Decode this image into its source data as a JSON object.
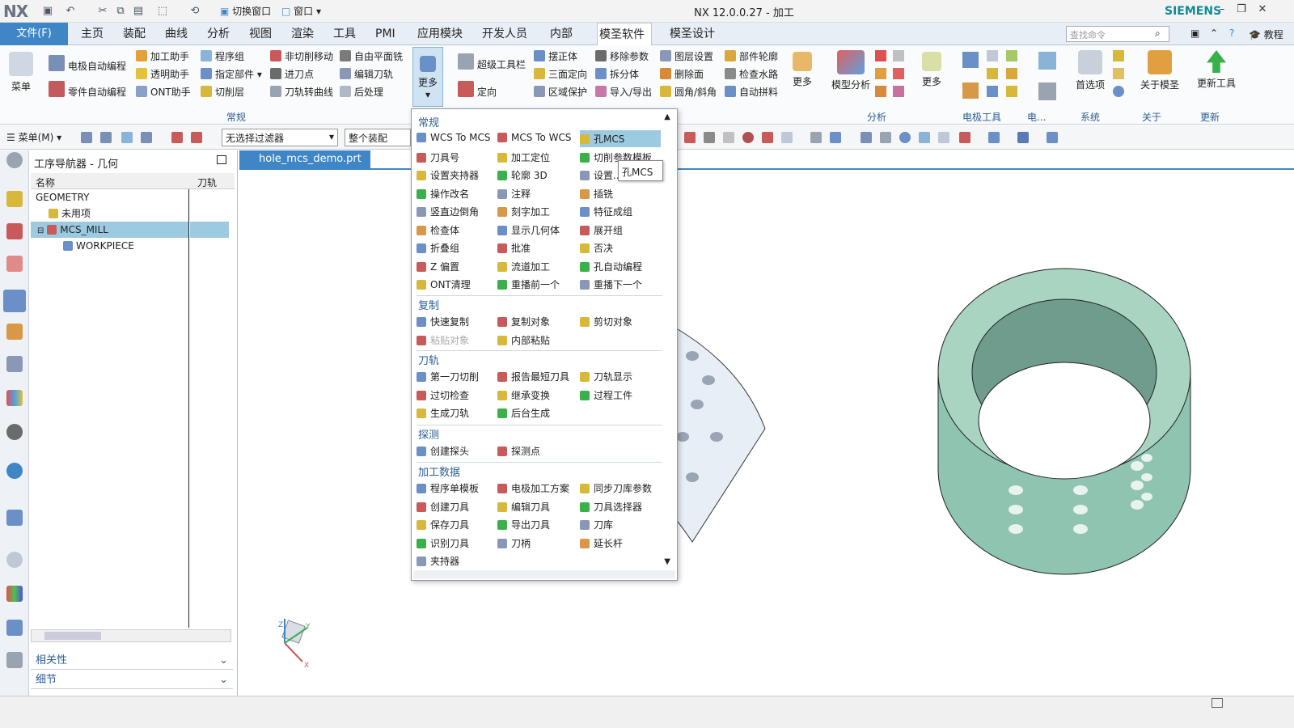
{
  "app": {
    "logo": "NX",
    "title": "NX 12.0.0.27 - 加工",
    "brand": "SIEMENS",
    "switch_window": "切换窗口",
    "window_menu": "窗口"
  },
  "menu_tabs": {
    "file": "文件(F)",
    "items": [
      "主页",
      "装配",
      "曲线",
      "分析",
      "视图",
      "渲染",
      "工具",
      "PMI",
      "应用模块",
      "开发人员",
      "内部",
      "模圣软件",
      "模圣设计"
    ],
    "active": "模圣软件",
    "search_placeholder": "查找命令",
    "tutorial": "教程"
  },
  "ribbon": {
    "menu_btn": "菜单",
    "col1": [
      "电极自动编程",
      "零件自动编程"
    ],
    "col2": [
      "加工助手",
      "透明助手",
      "ONT助手"
    ],
    "col3": [
      "程序组",
      "指定部件",
      "切削层"
    ],
    "col4": [
      "非切削移动",
      "进刀点",
      "刀轨转曲线"
    ],
    "col5": [
      "自由平面铣",
      "编辑刀轨",
      "后处理"
    ],
    "more1": "更多",
    "group_general": "常规",
    "super_toolbar": "超级工具栏",
    "orient": "定向",
    "col6": [
      "摆正体",
      "三面定向",
      "区域保护"
    ],
    "col7": [
      "移除参数",
      "拆分体",
      "导入/导出"
    ],
    "col8": [
      "图层设置",
      "删除面",
      "圆角/斜角"
    ],
    "col9": [
      "部件轮廓",
      "检查水路",
      "自动拼料"
    ],
    "more2": "更多",
    "model_analysis": "模型分析",
    "group_analysis": "分析",
    "more3": "更多",
    "group_electrode": "电极工具",
    "group_electrode2": "电...",
    "group_system": "系统",
    "preferences": "首选项",
    "about": "关于模圣",
    "group_about": "关于",
    "update_tools": "更新工具",
    "group_update": "更新"
  },
  "toolbar2": {
    "menu": "菜单(M)",
    "filter": "无选择过滤器",
    "assembly": "整个装配"
  },
  "navigator": {
    "title": "工序导航器 - 几何",
    "col_name": "名称",
    "col_path": "刀轨",
    "rows": [
      "GEOMETRY",
      "未用项",
      "MCS_MILL",
      "WORKPIECE"
    ],
    "dependencies": "相关性",
    "details": "细节"
  },
  "graphics": {
    "doc_tab": "hole_mcs_demo.prt"
  },
  "dropdown": {
    "sec_general": "常规",
    "general": [
      [
        "WCS To MCS",
        "MCS To WCS",
        "孔MCS"
      ],
      [
        "刀具号",
        "加工定位",
        "切削参数模板"
      ],
      [
        "设置夹持器",
        "轮廓 3D",
        "设置..."
      ],
      [
        "操作改名",
        "注释",
        "插铣"
      ],
      [
        "竖直边倒角",
        "刻字加工",
        "特征成组"
      ],
      [
        "检查体",
        "显示几何体",
        "展开组"
      ],
      [
        "折叠组",
        "批准",
        "否决"
      ],
      [
        "Z 偏置",
        "流道加工",
        "孔自动编程"
      ],
      [
        "ONT清理",
        "重播前一个",
        "重播下一个"
      ]
    ],
    "sec_copy": "复制",
    "copy": [
      [
        "快速复制",
        "复制对象",
        "剪切对象"
      ],
      [
        "粘贴对象",
        "内部粘贴",
        ""
      ]
    ],
    "sec_toolpath": "刀轨",
    "toolpath": [
      [
        "第一刀切削",
        "报告最短刀具",
        "刀轨显示"
      ],
      [
        "过切检查",
        "继承变换",
        "过程工件"
      ],
      [
        "生成刀轨",
        "后台生成",
        ""
      ]
    ],
    "sec_probe": "探测",
    "probe": [
      [
        "创建探头",
        "探测点",
        ""
      ]
    ],
    "sec_data": "加工数据",
    "data": [
      [
        "程序单模板",
        "电极加工方案",
        "同步刀库参数"
      ],
      [
        "创建刀具",
        "编辑刀具",
        "刀具选择器"
      ],
      [
        "保存刀具",
        "导出刀具",
        "刀库"
      ],
      [
        "识别刀具",
        "刀柄",
        "延长杆"
      ],
      [
        "夹持器",
        "",
        ""
      ]
    ],
    "tooltip": "孔MCS"
  },
  "colors": {
    "accent": "#3f86c6",
    "selection": "#9ccae0",
    "section_text": "#2d5e93",
    "model_fill": "#8fc4b0"
  }
}
